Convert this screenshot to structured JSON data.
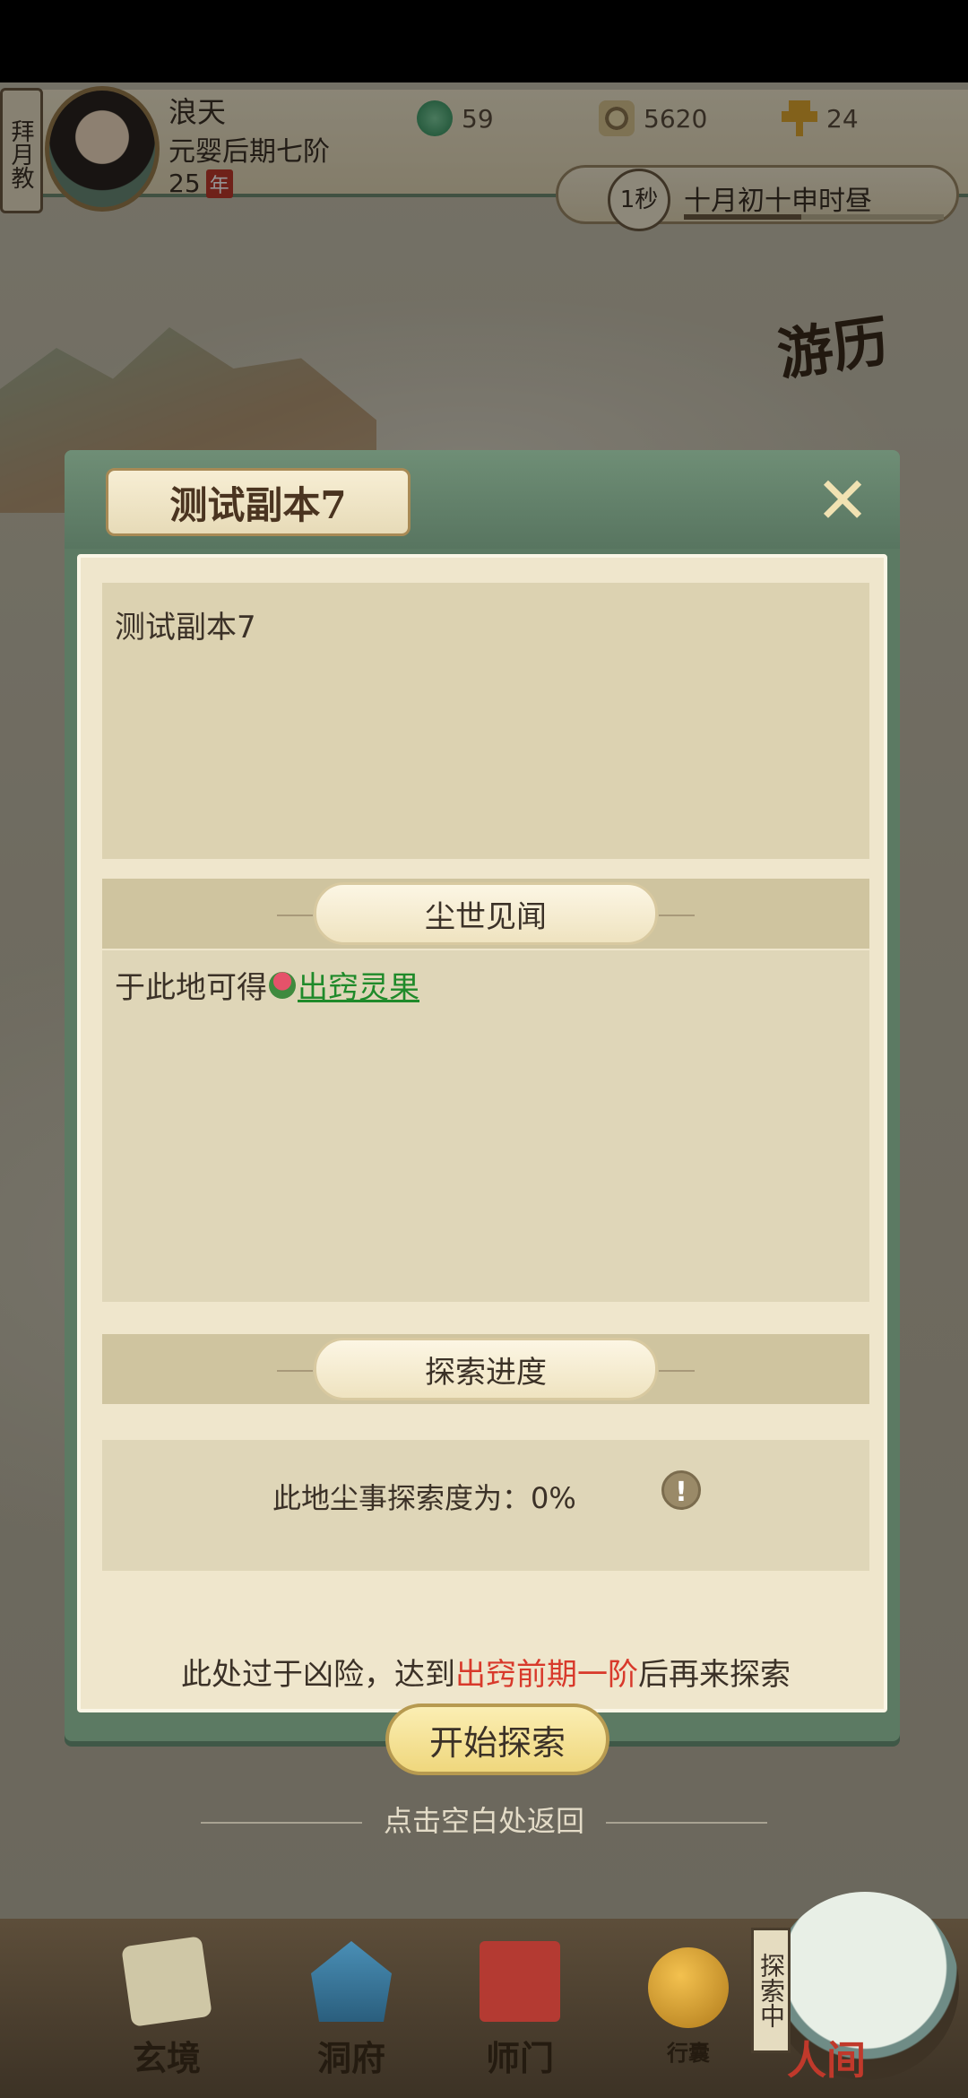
{
  "player": {
    "sect_tab": "拜月教",
    "name": "浪天",
    "realm": "元婴后期七阶",
    "age": "25",
    "age_unit": "年"
  },
  "resources": [
    {
      "icon": "jade-icon",
      "value": "59"
    },
    {
      "icon": "coin-icon",
      "value": "5620"
    },
    {
      "icon": "gold-ingot-icon",
      "value": "24"
    }
  ],
  "time": {
    "speed": "1秒",
    "text": "十月初十申时昼",
    "progress": 0.45
  },
  "travel_button": "游历",
  "modal": {
    "title": "测试副本7",
    "description": "测试副本7",
    "loot_section_title": "尘世见闻",
    "loot_prefix": "于此地可得",
    "loot_item": "出窍灵果",
    "progress_section_title": "探索进度",
    "progress_text": "此地尘事探索度为：0%",
    "warning_prefix": "此处过于凶险，达到",
    "warning_requirement": "出窍前期一阶",
    "warning_suffix": "后再来探索",
    "start_button": "开始探索"
  },
  "return_hint": "点击空白处返回",
  "bottom_nav": {
    "items": [
      "玄境",
      "洞府",
      "师门"
    ],
    "bag_label": "行囊",
    "exploring_tag": "探索中",
    "human_world": "人间"
  },
  "colors": {
    "accent_green": "#5c7a63",
    "link_green": "#1f8a2a",
    "warning_red": "#d8392b",
    "paper": "#efe6cc"
  }
}
